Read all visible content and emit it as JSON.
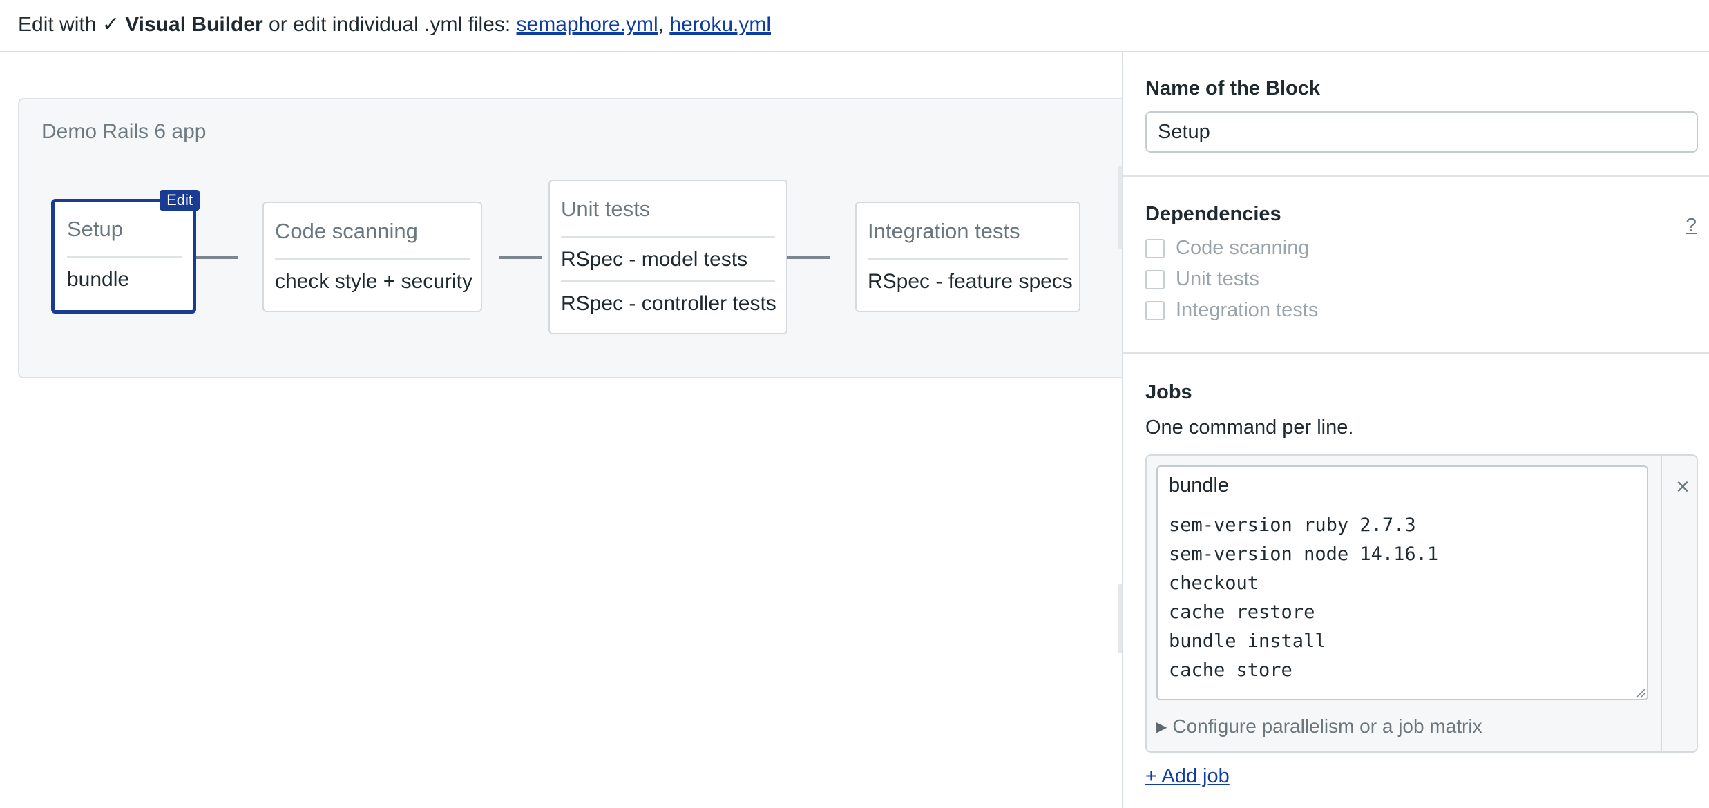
{
  "topbar": {
    "prefix": "Edit with ",
    "check": "✓",
    "builder": "Visual Builder",
    "middle": " or edit individual .yml files: ",
    "file1": "semaphore.yml",
    "sep": ",",
    "file2": "heroku.yml"
  },
  "workflow": {
    "pipeline_name": "Demo Rails 6 app",
    "edit_badge": "Edit",
    "blocks": [
      {
        "name": "Setup",
        "jobs": [
          "bundle"
        ]
      },
      {
        "name": "Code scanning",
        "jobs": [
          "check style + security"
        ]
      },
      {
        "name": "Unit tests",
        "jobs": [
          "RSpec - model tests",
          "RSpec - controller tests"
        ]
      },
      {
        "name": "Integration tests",
        "jobs": [
          "RSpec - feature specs"
        ]
      }
    ]
  },
  "panel": {
    "block_name_label": "Name of the Block",
    "block_name_value": "Setup",
    "dependencies_label": "Dependencies",
    "help": "?",
    "dependencies": [
      "Code scanning",
      "Unit tests",
      "Integration tests"
    ],
    "jobs_label": "Jobs",
    "jobs_hint": "One command per line.",
    "job": {
      "name": "bundle",
      "remove": "×",
      "commands": [
        "sem-version ruby 2.7.3",
        "sem-version node 14.16.1",
        "checkout",
        "cache restore",
        "bundle install",
        "cache store"
      ],
      "configure_label": "Configure parallelism or a job matrix",
      "configure_icon": "▶"
    },
    "add_job": "+ Add job"
  }
}
